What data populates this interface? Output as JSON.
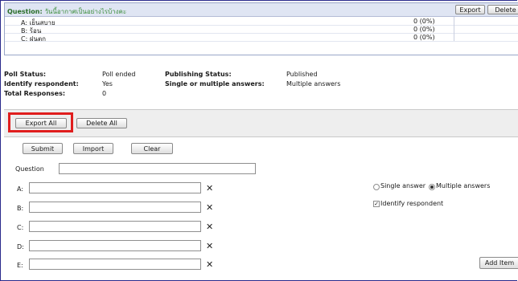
{
  "poll": {
    "question_label": "Question:",
    "question_text": "วันนี้อากาศเป็นอย่างไรบ้างคะ",
    "export_label": "Export",
    "delete_label": "Delete",
    "options": [
      {
        "label": "A: เย็นสบาย",
        "value": "0 (0%)"
      },
      {
        "label": "B: ร้อน",
        "value": "0 (0%)"
      },
      {
        "label": "C: ฝนตก",
        "value": "0 (0%)"
      }
    ],
    "status_label": "Poll Status:",
    "status_value": "Poll ended",
    "identify_label": "Identify respondent:",
    "identify_value": "Yes",
    "total_label": "Total Responses:",
    "total_value": "0",
    "publishing_label": "Publishing Status:",
    "publishing_value": "Published",
    "single_multi_label": "Single or multiple answers:",
    "single_multi_value": "Multiple answers"
  },
  "bulk": {
    "export_all": "Export All",
    "delete_all": "Delete All"
  },
  "form": {
    "submit": "Submit",
    "import": "Import",
    "clear": "Clear",
    "question_label": "Question",
    "question_value": "",
    "answers": [
      {
        "letter": "A:",
        "value": ""
      },
      {
        "letter": "B:",
        "value": ""
      },
      {
        "letter": "C:",
        "value": ""
      },
      {
        "letter": "D:",
        "value": ""
      },
      {
        "letter": "E:",
        "value": ""
      }
    ],
    "remove_glyph": "✕",
    "single_answer": "Single answer",
    "multiple_answers": "Multiple answers",
    "identify_respondent": "Identify respondent",
    "add_item": "Add Item"
  },
  "colors": {
    "highlight": "#e01e1e",
    "question_green": "#2a6e2a",
    "header_blue": "#dfe5f3"
  }
}
